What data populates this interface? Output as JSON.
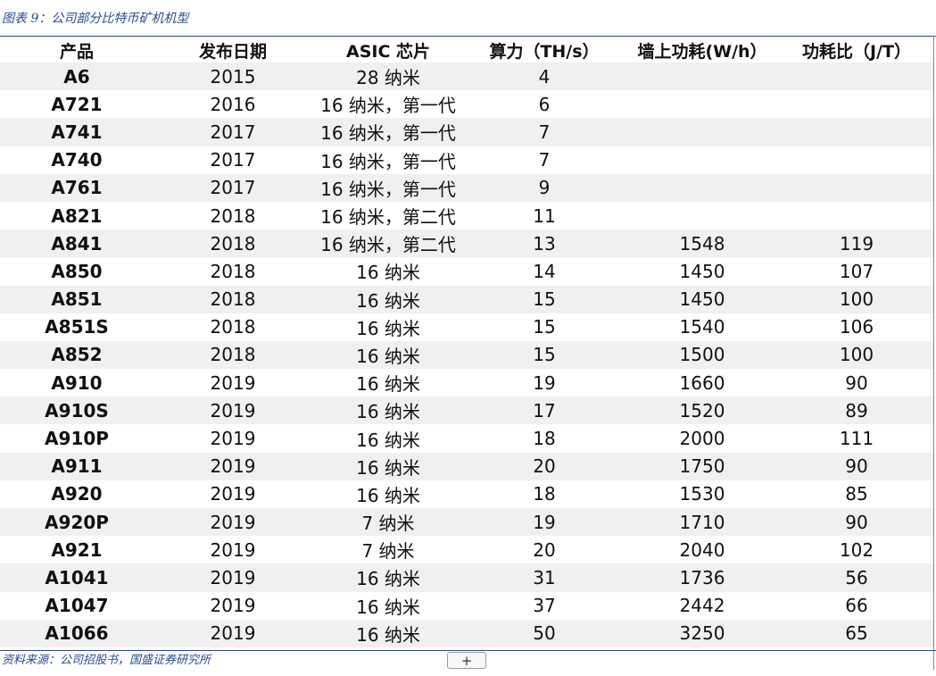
{
  "caption": "图表 9：公司部分比特币矿机机型",
  "table": {
    "headers": [
      "产品",
      "发布日期",
      "ASIC 芯片",
      "算力（TH/s）",
      "墙上功耗(W/h）",
      "功耗比（J/T）"
    ],
    "rows": [
      [
        "A6",
        "2015",
        "28 纳米",
        "4",
        "",
        ""
      ],
      [
        "A721",
        "2016",
        "16 纳米，第一代",
        "6",
        "",
        ""
      ],
      [
        "A741",
        "2017",
        "16 纳米，第一代",
        "7",
        "",
        ""
      ],
      [
        "A740",
        "2017",
        "16 纳米，第一代",
        "7",
        "",
        ""
      ],
      [
        "A761",
        "2017",
        "16 纳米，第一代",
        "9",
        "",
        ""
      ],
      [
        "A821",
        "2018",
        "16 纳米，第二代",
        "11",
        "",
        ""
      ],
      [
        "A841",
        "2018",
        "16 纳米，第二代",
        "13",
        "1548",
        "119"
      ],
      [
        "A850",
        "2018",
        "16 纳米",
        "14",
        "1450",
        "107"
      ],
      [
        "A851",
        "2018",
        "16 纳米",
        "15",
        "1450",
        "100"
      ],
      [
        "A851S",
        "2018",
        "16 纳米",
        "15",
        "1540",
        "106"
      ],
      [
        "A852",
        "2018",
        "16 纳米",
        "15",
        "1500",
        "100"
      ],
      [
        "A910",
        "2019",
        "16 纳米",
        "19",
        "1660",
        "90"
      ],
      [
        "A910S",
        "2019",
        "16 纳米",
        "17",
        "1520",
        "89"
      ],
      [
        "A910P",
        "2019",
        "16 纳米",
        "18",
        "2000",
        "111"
      ],
      [
        "A911",
        "2019",
        "16 纳米",
        "20",
        "1750",
        "90"
      ],
      [
        "A920",
        "2019",
        "16 纳米",
        "18",
        "1530",
        "85"
      ],
      [
        "A920P",
        "2019",
        "7 纳米",
        "19",
        "1710",
        "90"
      ],
      [
        "A921",
        "2019",
        "7 纳米",
        "20",
        "2040",
        "102"
      ],
      [
        "A1041",
        "2019",
        "16 纳米",
        "31",
        "1736",
        "56"
      ],
      [
        "A1047",
        "2019",
        "16 纳米",
        "37",
        "2442",
        "66"
      ],
      [
        "A1066",
        "2019",
        "16 纳米",
        "50",
        "3250",
        "65"
      ]
    ]
  },
  "source": "资料来源：公司招股书，国盛证券研究所",
  "add_button": "+"
}
